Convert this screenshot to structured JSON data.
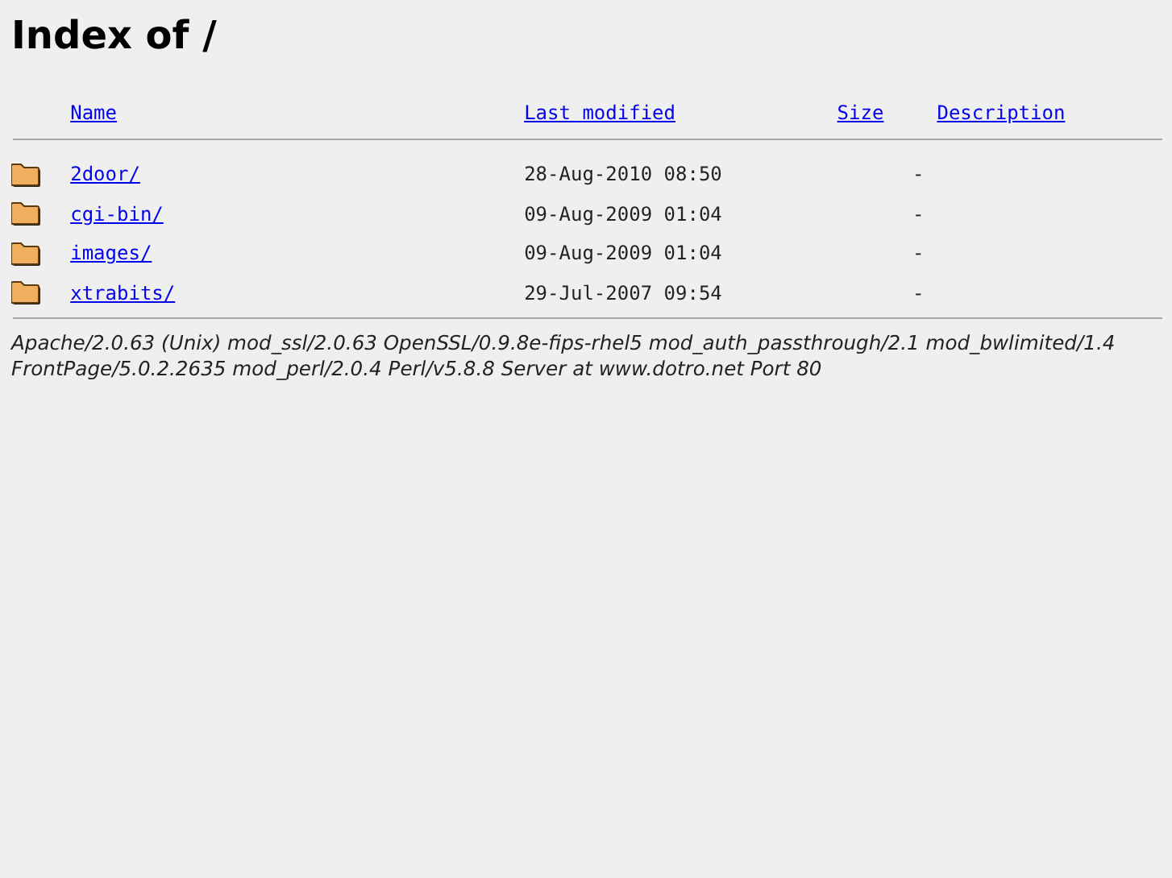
{
  "title": "Index of /",
  "table": {
    "columns": [
      "Name",
      "Last modified",
      "Size",
      "Description"
    ],
    "rows": [
      {
        "name": "2door/",
        "modified": "28-Aug-2010 08:50",
        "size": "-"
      },
      {
        "name": "cgi-bin/",
        "modified": "09-Aug-2009 01:04",
        "size": "-"
      },
      {
        "name": "images/",
        "modified": "09-Aug-2009 01:04",
        "size": "-"
      },
      {
        "name": "xtrabits/",
        "modified": "29-Jul-2007 09:54",
        "size": "-"
      }
    ]
  },
  "address": "Apache/2.0.63 (Unix) mod_ssl/2.0.63 OpenSSL/0.9.8e-fips-rhel5 mod_auth_passthrough/2.1 mod_bwlimited/1.4 FrontPage/5.0.2.2635 mod_perl/2.0.4 Perl/v5.8.8 Server at www.dotro.net Port 80"
}
